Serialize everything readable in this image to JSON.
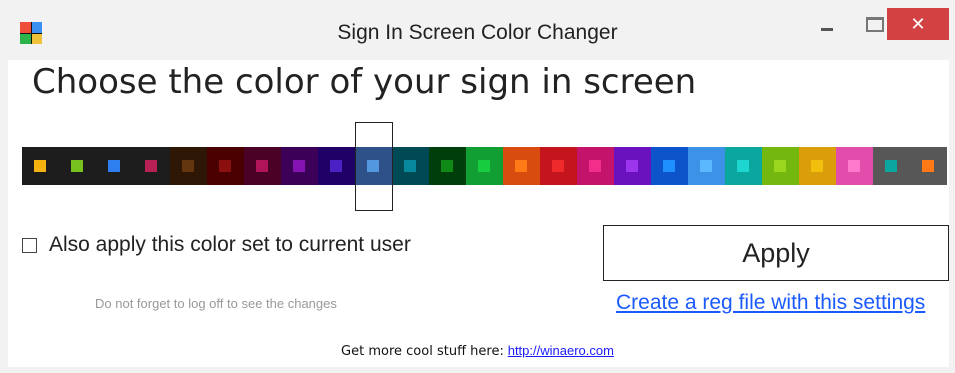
{
  "window": {
    "title": "Sign In Screen Color Changer",
    "close_symbol": "✕",
    "icon_colors": [
      "#f04c3a",
      "#3a8ff0",
      "#2bb34a",
      "#f0c23a"
    ]
  },
  "heading": "Choose the color of your sign in screen",
  "palette": {
    "selected_index": 9,
    "swatches": [
      {
        "bg": "#1d1d1d",
        "accent": "#f4b30f"
      },
      {
        "bg": "#1d1d1d",
        "accent": "#78c220"
      },
      {
        "bg": "#1d1d1d",
        "accent": "#2d7ff0"
      },
      {
        "bg": "#1d1d1d",
        "accent": "#b82156"
      },
      {
        "bg": "#2e1805",
        "accent": "#63360e"
      },
      {
        "bg": "#4a0000",
        "accent": "#8c0f0f"
      },
      {
        "bg": "#4b0025",
        "accent": "#b01459"
      },
      {
        "bg": "#3d0058",
        "accent": "#8512b3"
      },
      {
        "bg": "#1f0067",
        "accent": "#4b21c4"
      },
      {
        "bg": "#002b6f",
        "accent": "#2e81d8"
      },
      {
        "bg": "#004a56",
        "accent": "#07889c"
      },
      {
        "bg": "#003e0b",
        "accent": "#0f8a16"
      },
      {
        "bg": "#119f33",
        "accent": "#17cc3f"
      },
      {
        "bg": "#d94c0f",
        "accent": "#ff7a16"
      },
      {
        "bg": "#c4141e",
        "accent": "#ef2a2a"
      },
      {
        "bg": "#c4136a",
        "accent": "#f22d8a"
      },
      {
        "bg": "#6a12bd",
        "accent": "#9b35ee"
      },
      {
        "bg": "#0d53c9",
        "accent": "#1e90ff"
      },
      {
        "bg": "#3b92e6",
        "accent": "#5bb8ff"
      },
      {
        "bg": "#0aa79f",
        "accent": "#1ed6cf"
      },
      {
        "bg": "#74b80f",
        "accent": "#9bd61f"
      },
      {
        "bg": "#d99e0a",
        "accent": "#f2bf0f"
      },
      {
        "bg": "#e24dac",
        "accent": "#ff79cc"
      },
      {
        "bg": "#575757",
        "accent": "#0aa79f"
      },
      {
        "bg": "#575757",
        "accent": "#ff7a16"
      }
    ]
  },
  "options": {
    "apply_to_current_user_label": "Also apply this color set to current user",
    "apply_to_current_user_checked": false
  },
  "apply_button_label": "Apply",
  "note": "Do not forget to log off to see the changes",
  "reg_link_label": "Create a reg file with this settings",
  "footer": {
    "label": "Get more cool stuff here:",
    "link": "http://winaero.com"
  }
}
